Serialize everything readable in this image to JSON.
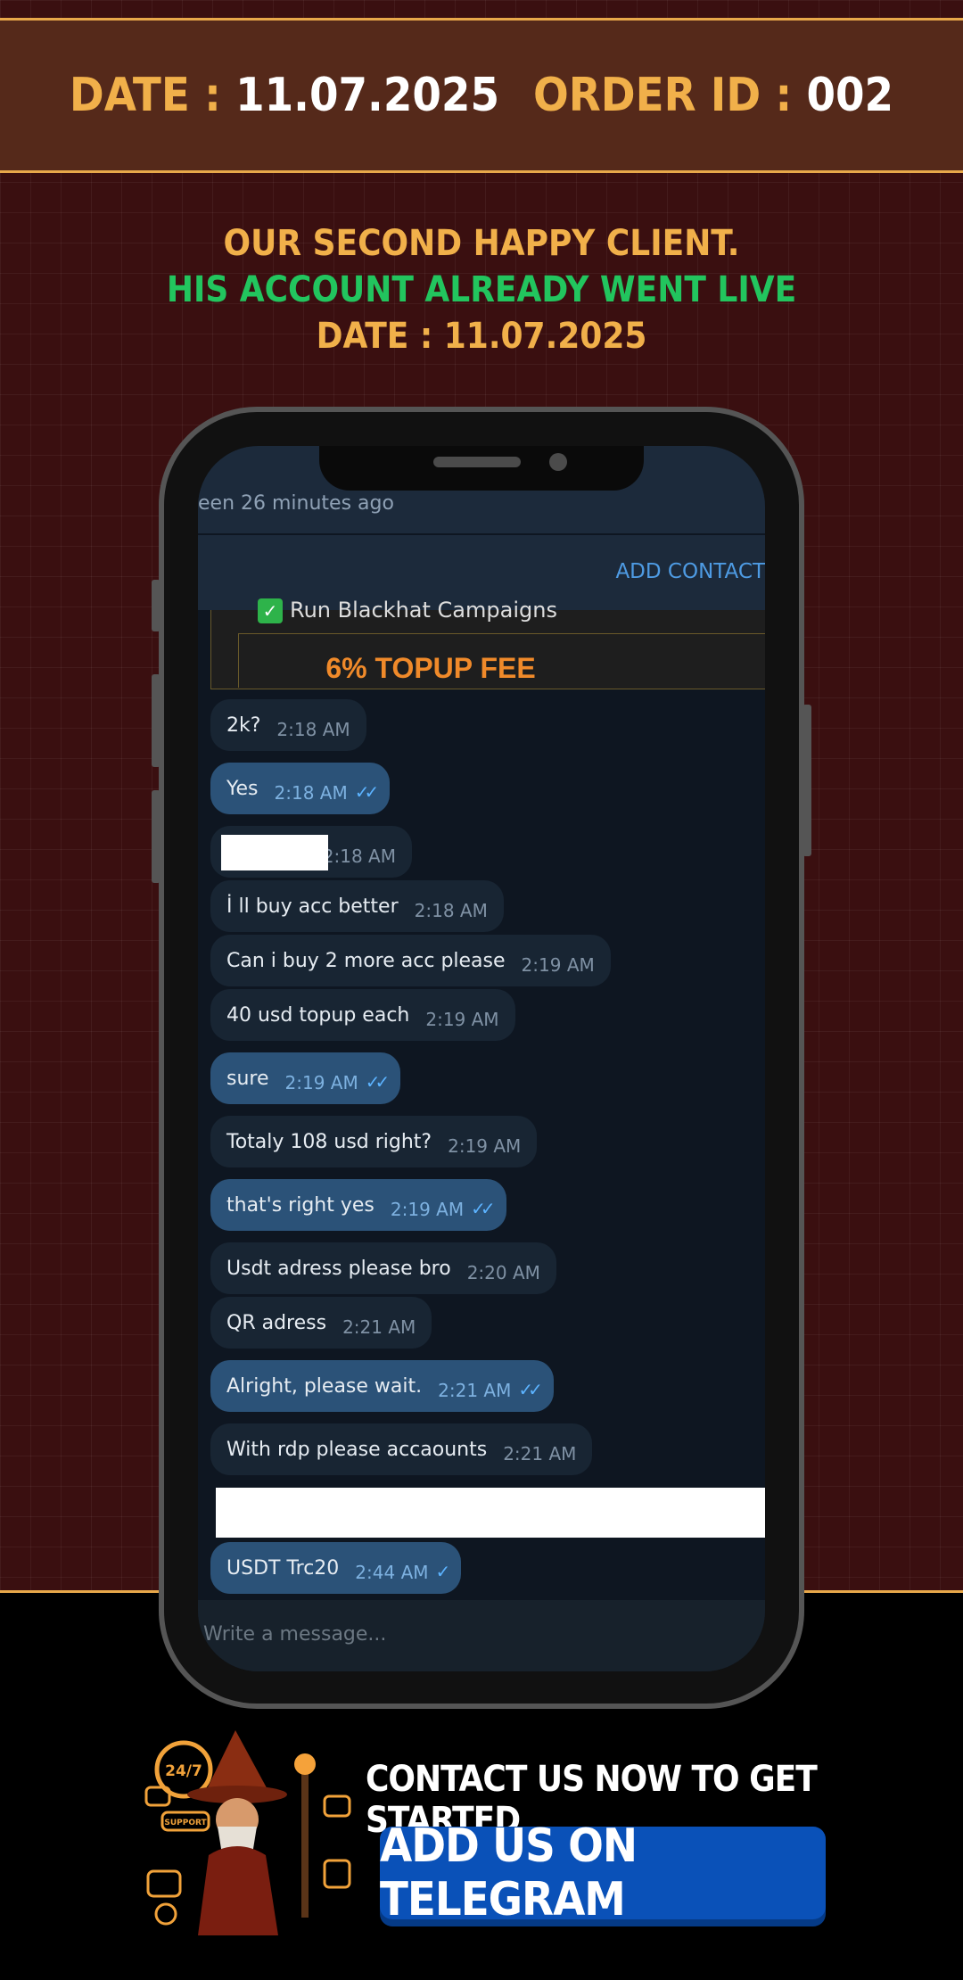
{
  "header": {
    "date_label": "DATE :",
    "date_value": "11.07.2025",
    "order_label": "ORDER ID :",
    "order_value": "002"
  },
  "promo": {
    "line1": "OUR SECOND HAPPY CLIENT.",
    "line2": "HIS ACCOUNT ALREADY WENT LIVE",
    "line3": "DATE : 11.07.2025"
  },
  "chat": {
    "last_seen": "een 26 minutes ago",
    "add_contact": "ADD CONTACT",
    "card_line": "Run Blackhat Campaigns",
    "card_fee": "6% TOPUP FEE",
    "input_placeholder": "Write a message...",
    "messages": [
      {
        "dir": "in",
        "text": "2k?",
        "time": "2:18 AM"
      },
      {
        "dir": "out",
        "text": "Yes",
        "time": "2:18 AM"
      },
      {
        "dir": "in",
        "text": "",
        "time": "2:18 AM"
      },
      {
        "dir": "in",
        "text": "İ ll buy acc better",
        "time": "2:18 AM"
      },
      {
        "dir": "in",
        "text": "Can i buy 2 more acc please",
        "time": "2:19 AM"
      },
      {
        "dir": "in",
        "text": "40 usd topup each",
        "time": "2:19 AM"
      },
      {
        "dir": "out",
        "text": "sure",
        "time": "2:19 AM"
      },
      {
        "dir": "in",
        "text": "Totaly 108 usd right?",
        "time": "2:19 AM"
      },
      {
        "dir": "out",
        "text": "that's right yes",
        "time": "2:19 AM"
      },
      {
        "dir": "in",
        "text": "Usdt adress please bro",
        "time": "2:20 AM"
      },
      {
        "dir": "in",
        "text": "QR adress",
        "time": "2:21 AM"
      },
      {
        "dir": "out",
        "text": "Alright, please wait.",
        "time": "2:21 AM"
      },
      {
        "dir": "in",
        "text": "With rdp please accaounts",
        "time": "2:21 AM"
      },
      {
        "dir": "out",
        "text": "USDT Trc20",
        "time": "2:44 AM"
      }
    ]
  },
  "cta": {
    "contact_text": "CONTACT US NOW TO GET STARTED",
    "button_label": "ADD US ON TELEGRAM",
    "badge_247": "24/7",
    "badge_support": "SUPPORT"
  },
  "colors": {
    "background": "#3a0f10",
    "accent_orange": "#f1b04a",
    "accent_green": "#22c55e",
    "telegram_blue": "#0a51b8"
  }
}
